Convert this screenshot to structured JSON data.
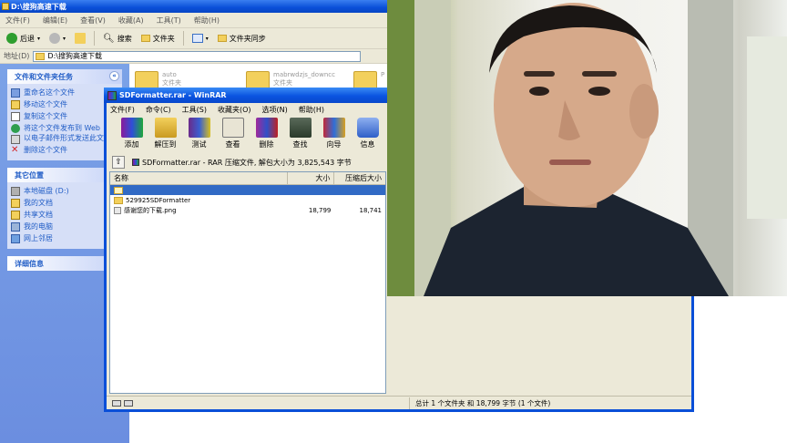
{
  "explorer": {
    "title": "D:\\搜狗高速下载",
    "menu": [
      "文件(F)",
      "编辑(E)",
      "查看(V)",
      "收藏(A)",
      "工具(T)",
      "帮助(H)"
    ],
    "toolbar": {
      "back": "后退",
      "search": "搜索",
      "folders": "文件夹",
      "sync": "文件夹同步"
    },
    "address_label": "地址(D)",
    "address_value": "D:\\搜狗高速下载",
    "taskpane": {
      "file_tasks_title": "文件和文件夹任务",
      "file_tasks": [
        "重命名这个文件",
        "移动这个文件",
        "复制这个文件",
        "将这个文件发布到 Web",
        "以电子邮件形式发送此文件",
        "删除这个文件"
      ],
      "other_places_title": "其它位置",
      "other_places": [
        "本地磁盘 (D:)",
        "我的文档",
        "共享文档",
        "我的电脑",
        "网上邻居"
      ],
      "details_title": "详细信息"
    },
    "folders": [
      {
        "name": "auto",
        "type": "文件夹"
      },
      {
        "name": "mabrwdzjs_downcc",
        "type": "文件夹"
      },
      {
        "name": "P",
        "type": ""
      }
    ]
  },
  "winrar": {
    "title": "SDFormatter.rar - WinRAR",
    "menu": [
      "文件(F)",
      "命令(C)",
      "工具(S)",
      "收藏夹(O)",
      "选项(N)",
      "帮助(H)"
    ],
    "tools": [
      "添加",
      "解压到",
      "测试",
      "查看",
      "删除",
      "查找",
      "向导",
      "信息"
    ],
    "path_text": "SDFormatter.rar - RAR 压缩文件, 解包大小为 3,825,543 字节",
    "columns": {
      "name": "名称",
      "size": "大小",
      "packed": "压缩后大小"
    },
    "files": [
      {
        "name": "529925SDFormatter",
        "size": "",
        "packed": ""
      },
      {
        "name": "感谢您的下载.png",
        "size": "18,799",
        "packed": "18,741"
      }
    ],
    "status": "总计 1 个文件夹 和 18,799 字节 (1 个文件)"
  }
}
